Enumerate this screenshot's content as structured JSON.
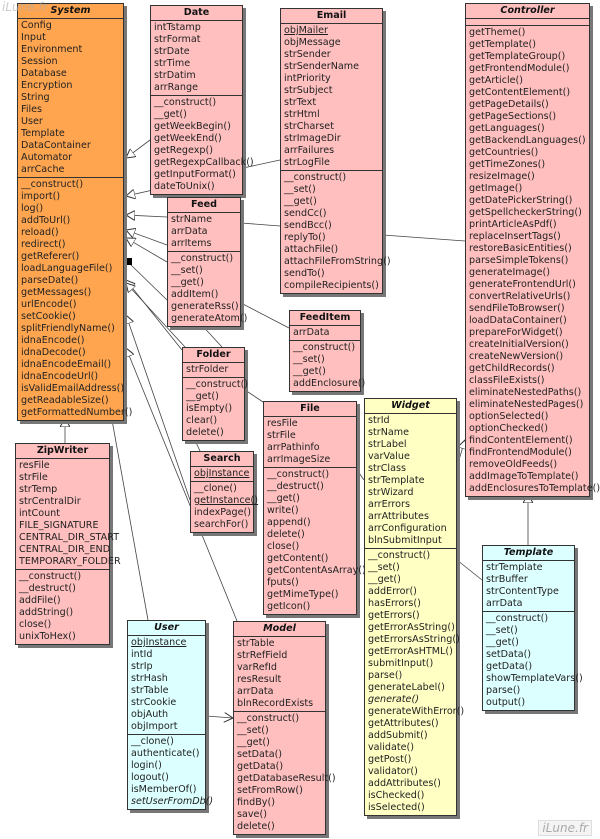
{
  "watermark": "iLune.fr",
  "colors": {
    "system": "#ffa54f",
    "class": "#ffbfbf",
    "widget": "#ffffc4",
    "abstract_cyan": "#dcffff"
  },
  "classes": {
    "system": {
      "name": "System",
      "abstract": true,
      "color": "orange",
      "attributes": [
        "Config",
        "Input",
        "Environment",
        "Session",
        "Database",
        "Encryption",
        "String",
        "Files",
        "User",
        "Template",
        "DataContainer",
        "Automator",
        "arrCache"
      ],
      "methods": [
        "__construct()",
        "import()",
        "log()",
        "addToUrl()",
        "reload()",
        "redirect()",
        "getReferer()",
        "loadLanguageFile()",
        "parseDate()",
        "getMessages()",
        "urlEncode()",
        "setCookie()",
        "splitFriendlyName()",
        "idnaEncode()",
        "idnaDecode()",
        "idnaEncodeEmail()",
        "idnaEncodeUrl()",
        "isValidEmailAddress()",
        "getReadableSize()",
        "getFormattedNumber()"
      ]
    },
    "date": {
      "name": "Date",
      "abstract": false,
      "color": "pink",
      "attributes": [
        "intTstamp",
        "strFormat",
        "strDate",
        "strTime",
        "strDatim",
        "arrRange"
      ],
      "methods": [
        "__construct()",
        "__get()",
        "getWeekBegin()",
        "getWeekEnd()",
        "getRegexp()",
        "getRegexpCallback()",
        "getInputFormat()",
        "dateToUnix()"
      ]
    },
    "email": {
      "name": "Email",
      "abstract": false,
      "color": "pink",
      "attributes": [
        "objMailer",
        "objMessage",
        "strSender",
        "strSenderName",
        "intPriority",
        "strSubject",
        "strText",
        "strHtml",
        "strCharset",
        "strImageDir",
        "arrFailures",
        "strLogFile"
      ],
      "static": [
        "objMailer"
      ],
      "methods": [
        "__construct()",
        "__set()",
        "__get()",
        "sendCc()",
        "sendBcc()",
        "replyTo()",
        "attachFile()",
        "attachFileFromString()",
        "sendTo()",
        "compileRecipients()"
      ]
    },
    "controller": {
      "name": "Controller",
      "abstract": true,
      "color": "pink",
      "attributes": [],
      "methods": [
        "getTheme()",
        "getTemplate()",
        "getTemplateGroup()",
        "getFrontendModule()",
        "getArticle()",
        "getContentElement()",
        "getPageDetails()",
        "getPageSections()",
        "getLanguages()",
        "getBackendLanguages()",
        "getCountries()",
        "getTimeZones()",
        "resizeImage()",
        "getImage()",
        "getDatePickerString()",
        "getSpellcheckerString()",
        "printArticleAsPdf()",
        "replaceInsertTags()",
        "restoreBasicEntities()",
        "parseSimpleTokens()",
        "generateImage()",
        "generateFrontendUrl()",
        "convertRelativeUrls()",
        "sendFileToBrowser()",
        "loadDataContainer()",
        "prepareForWidget()",
        "createInitialVersion()",
        "createNewVersion()",
        "getChildRecords()",
        "classFileExists()",
        "eliminateNestedPaths()",
        "eliminateNestedPages()",
        "optionSelected()",
        "optionChecked()",
        "findContentElement()",
        "findFrontendModule()",
        "removeOldFeeds()",
        "addImageToTemplate()",
        "addEnclosuresToTemplate()"
      ]
    },
    "feed": {
      "name": "Feed",
      "abstract": false,
      "color": "pink",
      "attributes": [
        "strName",
        "arrData",
        "arrItems"
      ],
      "methods": [
        "__construct()",
        "__set()",
        "__get()",
        "addItem()",
        "generateRss()",
        "generateAtom()"
      ]
    },
    "feeditem": {
      "name": "FeedItem",
      "abstract": false,
      "color": "pink",
      "attributes": [
        "arrData"
      ],
      "methods": [
        "__construct()",
        "__set()",
        "__get()",
        "addEnclosure()"
      ]
    },
    "folder": {
      "name": "Folder",
      "abstract": false,
      "color": "pink",
      "attributes": [
        "strFolder"
      ],
      "methods": [
        "__construct()",
        "__get()",
        "isEmpty()",
        "clear()",
        "delete()"
      ]
    },
    "file": {
      "name": "File",
      "abstract": false,
      "color": "pink",
      "attributes": [
        "resFile",
        "strFile",
        "arrPathinfo",
        "arrImageSize"
      ],
      "methods": [
        "__construct()",
        "__destruct()",
        "__get()",
        "write()",
        "append()",
        "delete()",
        "close()",
        "getContent()",
        "getContentAsArray()",
        "fputs()",
        "getMimeType()",
        "getIcon()"
      ]
    },
    "widget": {
      "name": "Widget",
      "abstract": true,
      "color": "yellow",
      "attributes": [
        "strId",
        "strName",
        "strLabel",
        "varValue",
        "strClass",
        "strTemplate",
        "strWizard",
        "arrErrors",
        "arrAttributes",
        "arrConfiguration",
        "blnSubmitInput"
      ],
      "methods": [
        "__construct()",
        "__set()",
        "__get()",
        "addError()",
        "hasErrors()",
        "getErrors()",
        "getErrorAsString()",
        "getErrorsAsString()",
        "getErrorAsHTML()",
        "submitInput()",
        "parse()",
        "generateLabel()",
        "generate()",
        "generateWithError()",
        "getAttributes()",
        "addSubmit()",
        "validate()",
        "getPost()",
        "validator()",
        "addAttributes()",
        "isChecked()",
        "isSelected()"
      ],
      "abstract_methods": [
        "generate()"
      ]
    },
    "search": {
      "name": "Search",
      "abstract": false,
      "color": "pink",
      "attributes": [
        "objInstance"
      ],
      "static": [
        "objInstance",
        "getInstance()"
      ],
      "methods": [
        "__clone()",
        "getInstance()",
        "indexPage()",
        "searchFor()"
      ]
    },
    "zipwriter": {
      "name": "ZipWriter",
      "abstract": false,
      "color": "pink",
      "attributes": [
        "resFile",
        "strFile",
        "strTemp",
        "strCentralDir",
        "intCount",
        "FILE_SIGNATURE",
        "CENTRAL_DIR_START",
        "CENTRAL_DIR_END",
        "TEMPORARY_FOLDER"
      ],
      "methods": [
        "__construct()",
        "__destruct()",
        "addFile()",
        "addString()",
        "close()",
        "unixToHex()"
      ]
    },
    "template": {
      "name": "Template",
      "abstract": true,
      "color": "cyan",
      "attributes": [
        "strTemplate",
        "strBuffer",
        "strContentType",
        "arrData"
      ],
      "methods": [
        "__construct()",
        "__set()",
        "__get()",
        "setData()",
        "getData()",
        "showTemplateVars()",
        "parse()",
        "output()"
      ]
    },
    "user": {
      "name": "User",
      "abstract": true,
      "color": "cyan",
      "attributes": [
        "objInstance",
        "intId",
        "strIp",
        "strHash",
        "strTable",
        "strCookie",
        "objAuth",
        "objImport"
      ],
      "static": [
        "objInstance"
      ],
      "methods": [
        "__clone()",
        "authenticate()",
        "login()",
        "logout()",
        "isMemberOf()",
        "setUserFromDb()"
      ],
      "abstract_methods": [
        "setUserFromDb()"
      ]
    },
    "model": {
      "name": "Model",
      "abstract": true,
      "color": "pink",
      "attributes": [
        "strTable",
        "strRefField",
        "varRefId",
        "resResult",
        "arrData",
        "blnRecordExists"
      ],
      "methods": [
        "__construct()",
        "__set()",
        "__get()",
        "setData()",
        "getData()",
        "getDatabaseResult()",
        "setFromRow()",
        "findBy()",
        "save()",
        "delete()"
      ]
    }
  }
}
